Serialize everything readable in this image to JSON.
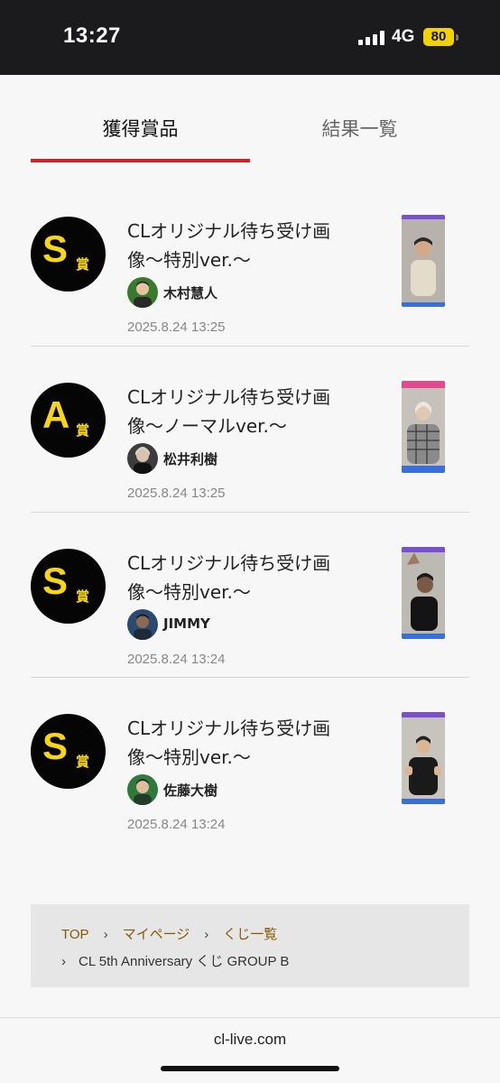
{
  "status_bar": {
    "time": "13:27",
    "network": "4G",
    "battery": "80"
  },
  "tabs": {
    "active": "獲得賞品",
    "inactive": "結果一覧"
  },
  "prizes": [
    {
      "rank_letter": "S",
      "rank_suffix": "賞",
      "title_line1": "CLオリジナル待ち受け画",
      "title_line2": "像〜特別ver.〜",
      "member": "木村慧人",
      "date": "2025.8.24 13:25"
    },
    {
      "rank_letter": "A",
      "rank_suffix": "賞",
      "title_line1": "CLオリジナル待ち受け画",
      "title_line2": "像〜ノーマルver.〜",
      "member": "松井利樹",
      "date": "2025.8.24 13:25"
    },
    {
      "rank_letter": "S",
      "rank_suffix": "賞",
      "title_line1": "CLオリジナル待ち受け画",
      "title_line2": "像〜特別ver.〜",
      "member": "JIMMY",
      "date": "2025.8.24 13:24"
    },
    {
      "rank_letter": "S",
      "rank_suffix": "賞",
      "title_line1": "CLオリジナル待ち受け画",
      "title_line2": "像〜特別ver.〜",
      "member": "佐藤大樹",
      "date": "2025.8.24 13:24"
    }
  ],
  "breadcrumb": {
    "top": "TOP",
    "separator": "›",
    "mypage": "マイページ",
    "lottery_list": "くじ一覧",
    "current": "CL 5th Anniversary くじ GROUP B"
  },
  "browser": {
    "url": "cl-live.com"
  },
  "colors": {
    "accent": "#d32027",
    "badge_bg": "#050505",
    "badge_text": "#f7d617",
    "link": "#8a5a00"
  }
}
